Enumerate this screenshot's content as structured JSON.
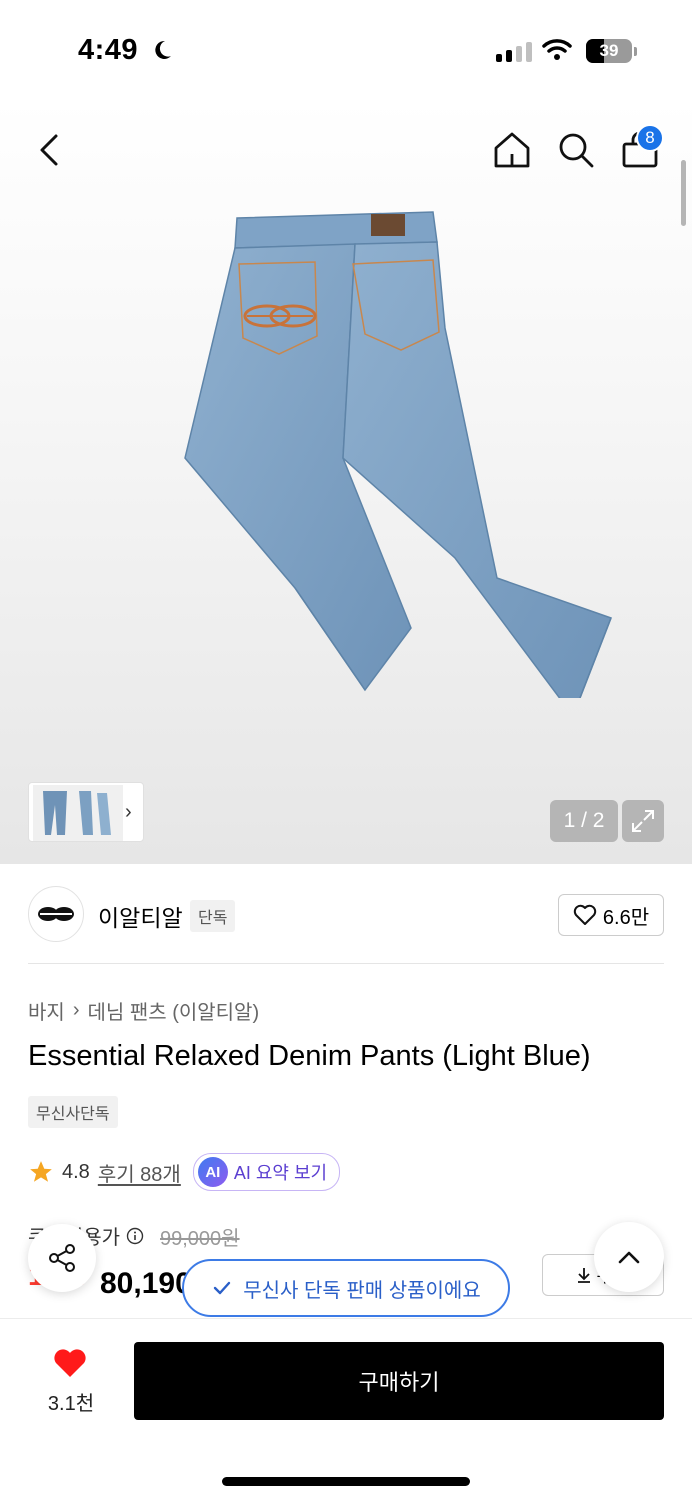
{
  "status_bar": {
    "time": "4:49",
    "battery": "39"
  },
  "header": {
    "cart_count": "8"
  },
  "gallery": {
    "page_indicator": "1 / 2",
    "thumb_arrow": "›"
  },
  "brand": {
    "name": "이알티알",
    "tag": "단독",
    "likes": "6.6만"
  },
  "product": {
    "breadcrumb": [
      "바지",
      "데님 팬츠 (이알티알)"
    ],
    "breadcrumb_sep": "›",
    "title": "Essential Relaxed Denim Pants (Light Blue)",
    "exclusive_tag": "무신사단독",
    "rating": "4.8",
    "reviews": "후기 88개",
    "ai_badge": "AI",
    "ai_summary": "AI 요약 보기",
    "price_label": "쿠폰적용가",
    "original_price": "99,000원",
    "sale_percent": "19%",
    "sale_price": "80,190원",
    "coupon_label": "쿠폰"
  },
  "toast": {
    "text": "무신사 단독 판매 상품이에요"
  },
  "bottom_bar": {
    "wish_count": "3.1천",
    "buy_label": "구매하기"
  },
  "colors": {
    "accent_blue": "#1a73e8",
    "sale_red": "#ff3b30",
    "ai_purple": "#5b3fd1"
  }
}
